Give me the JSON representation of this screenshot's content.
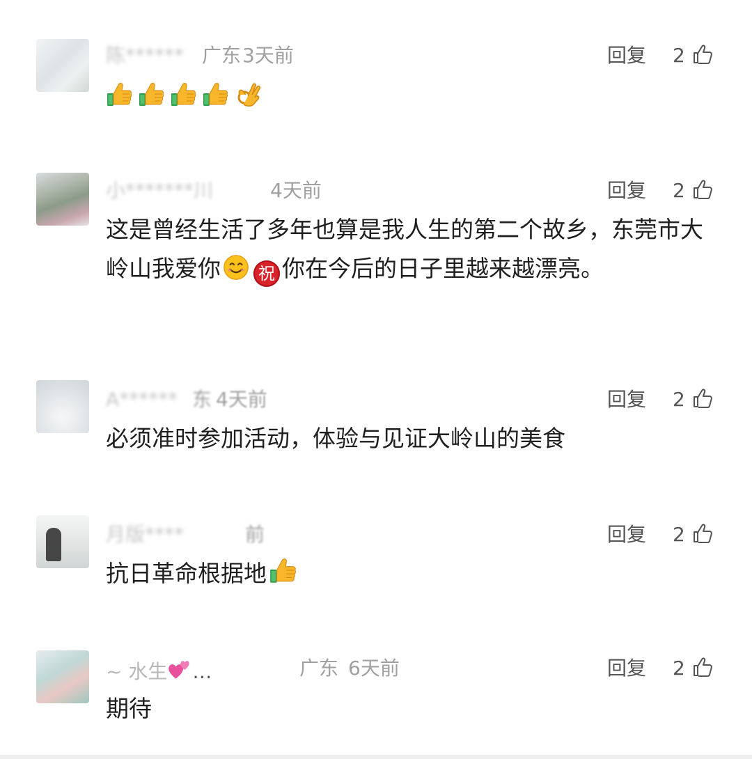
{
  "comments": [
    {
      "name": "陈******",
      "location": "广东",
      "time": "3天前",
      "reply": "回复",
      "likes": "2",
      "text": "",
      "emoji": [
        "thumbs-up",
        "thumbs-up",
        "thumbs-up",
        "thumbs-up",
        "ok-hand"
      ]
    },
    {
      "name": "小*******川",
      "location": "",
      "time": "4天前",
      "reply": "回复",
      "likes": "2",
      "text_a": "这是曾经生活了多年也算是我人生的第二个故乡，东莞市大岭山我爱你",
      "text_b": "你在今后的日子里越来越漂亮。",
      "inline_emoji": [
        "smile",
        "zhu-congratulate"
      ]
    },
    {
      "name": "A******",
      "location": "东",
      "time": "4天前",
      "reply": "回复",
      "likes": "2",
      "text": "必须准时参加活动，体验与见证大岭山的美食"
    },
    {
      "name": "月版****",
      "location": "",
      "time": "前",
      "reply": "回复",
      "likes": "2",
      "text": "抗日革命根据地",
      "trailing_emoji": "thumbs-up"
    },
    {
      "name": "~ 水生",
      "name_suffix": "…",
      "name_emoji": "two-hearts",
      "location": "广东",
      "time": "6天前",
      "reply": "回复",
      "likes": "2",
      "text": "期待"
    }
  ],
  "zhu_char": "祝",
  "colors": {
    "name_gray": "#c0c0c0",
    "meta_gray": "#a0a0a0",
    "action_gray": "#555555",
    "text_dark": "#1f1f1f"
  }
}
